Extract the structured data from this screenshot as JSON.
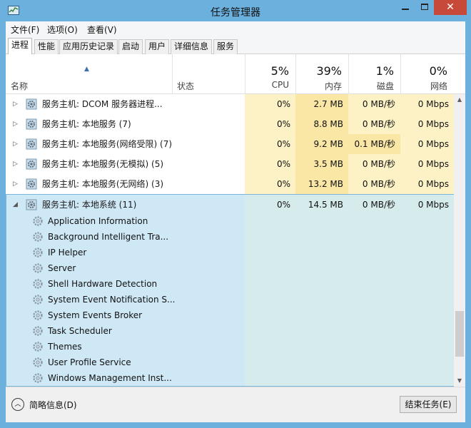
{
  "window": {
    "title": "任务管理器",
    "close_glyph": "✕"
  },
  "menu": {
    "file": "文件(F)",
    "options": "选项(O)",
    "view": "查看(V)"
  },
  "tabs": [
    {
      "label": "进程",
      "active": true
    },
    {
      "label": "性能"
    },
    {
      "label": "应用历史记录"
    },
    {
      "label": "启动"
    },
    {
      "label": "用户"
    },
    {
      "label": "详细信息"
    },
    {
      "label": "服务"
    }
  ],
  "columns": {
    "name": "名称",
    "status": "状态",
    "cpu": {
      "pct": "5%",
      "label": "CPU"
    },
    "memory": {
      "pct": "39%",
      "label": "内存"
    },
    "disk": {
      "pct": "1%",
      "label": "磁盘"
    },
    "network": {
      "pct": "0%",
      "label": "网络"
    }
  },
  "processes": [
    {
      "name": "服务主机: DCOM 服务器进程...",
      "cpu": "0%",
      "memory": "2.7 MB",
      "disk": "0 MB/秒",
      "network": "0 Mbps"
    },
    {
      "name": "服务主机: 本地服务 (7)",
      "cpu": "0%",
      "memory": "8.8 MB",
      "disk": "0 MB/秒",
      "network": "0 Mbps"
    },
    {
      "name": "服务主机: 本地服务(网络受限) (7)",
      "cpu": "0%",
      "memory": "9.2 MB",
      "disk": "0.1 MB/秒",
      "network": "0 Mbps"
    },
    {
      "name": "服务主机: 本地服务(无模拟) (5)",
      "cpu": "0%",
      "memory": "3.5 MB",
      "disk": "0 MB/秒",
      "network": "0 Mbps"
    },
    {
      "name": "服务主机: 本地服务(无网络) (3)",
      "cpu": "0%",
      "memory": "13.2 MB",
      "disk": "0 MB/秒",
      "network": "0 Mbps"
    }
  ],
  "expanded_group": {
    "name": "服务主机: 本地系统 (11)",
    "cpu": "0%",
    "memory": "14.5 MB",
    "disk": "0 MB/秒",
    "network": "0 Mbps",
    "services": [
      "Application Information",
      "Background Intelligent Tra...",
      "IP Helper",
      "Server",
      "Shell Hardware Detection",
      "System Event Notification S...",
      "System Events Broker",
      "Task Scheduler",
      "Themes",
      "User Profile Service",
      "Windows Management Inst..."
    ]
  },
  "footer": {
    "fewer_details": "简略信息(D)",
    "end_task": "结束任务(E)"
  }
}
